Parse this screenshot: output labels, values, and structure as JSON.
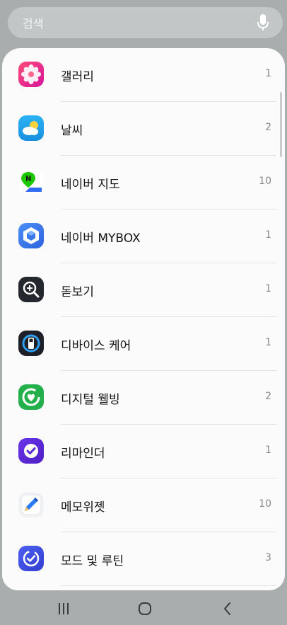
{
  "search": {
    "placeholder": "검색"
  },
  "apps": [
    {
      "name": "갤러리",
      "count": "1",
      "icon": "gallery-flower-icon"
    },
    {
      "name": "날씨",
      "count": "2",
      "icon": "weather-cloud-sun-icon"
    },
    {
      "name": "네이버 지도",
      "count": "10",
      "icon": "naver-map-pin-icon"
    },
    {
      "name": "네이버 MYBOX",
      "count": "1",
      "icon": "naver-mybox-cube-icon"
    },
    {
      "name": "돋보기",
      "count": "1",
      "icon": "magnifier-icon"
    },
    {
      "name": "디바이스 케어",
      "count": "1",
      "icon": "device-care-battery-icon"
    },
    {
      "name": "디지털 웰빙",
      "count": "2",
      "icon": "digital-wellbeing-heart-icon"
    },
    {
      "name": "리마인더",
      "count": "1",
      "icon": "reminder-check-icon"
    },
    {
      "name": "메모위젯",
      "count": "10",
      "icon": "memo-pen-icon"
    },
    {
      "name": "모드 및 루틴",
      "count": "3",
      "icon": "modes-routines-icon"
    }
  ],
  "navbar": {
    "buttons": [
      "recent-apps",
      "home",
      "back"
    ]
  }
}
